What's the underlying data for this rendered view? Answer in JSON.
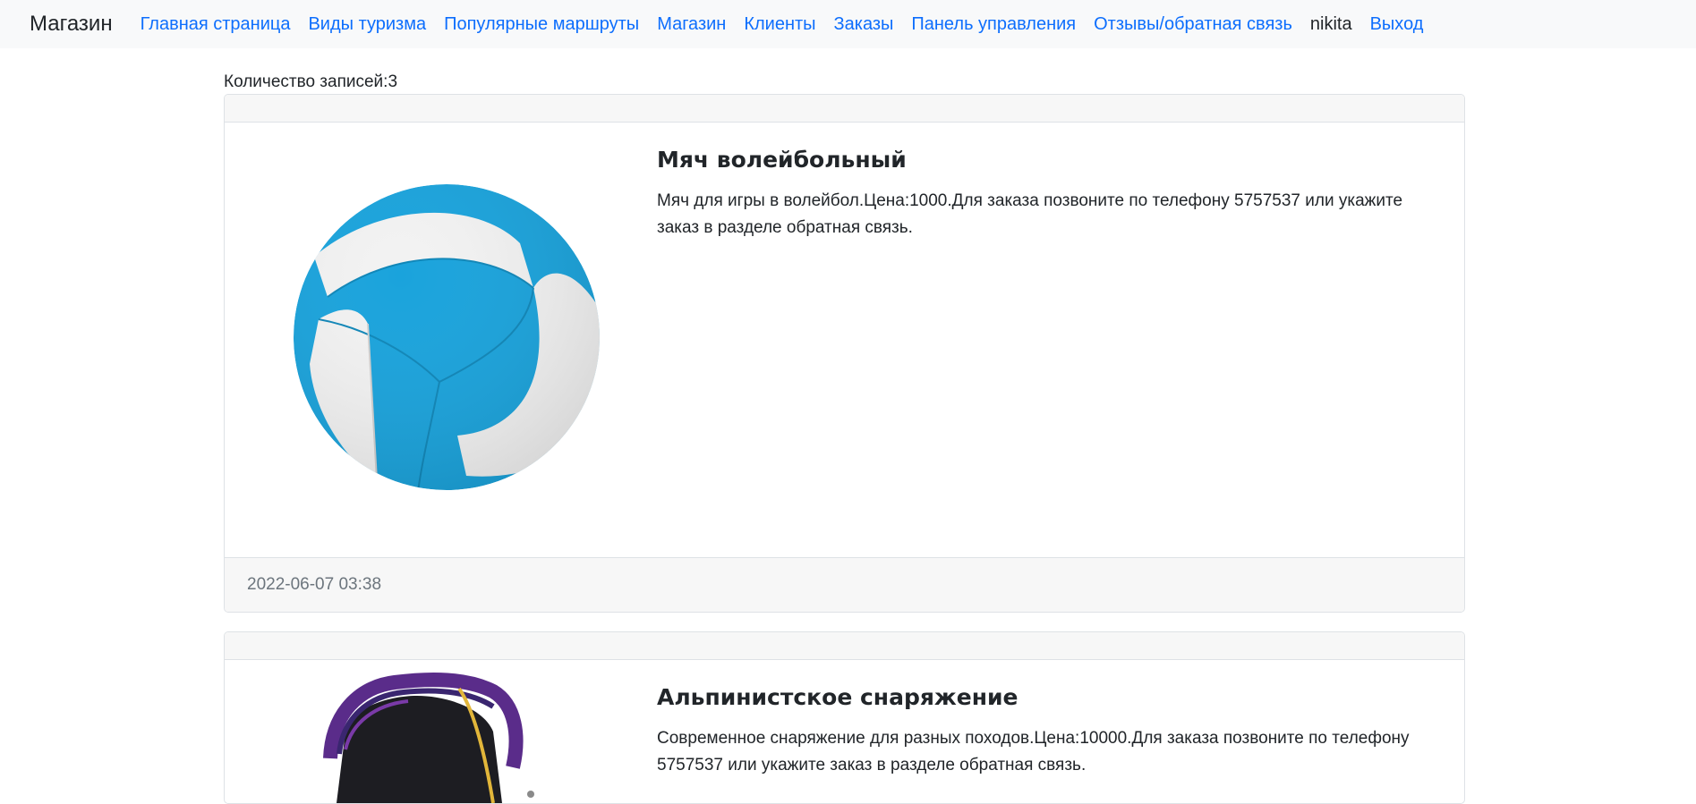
{
  "navbar": {
    "brand": "Магазин",
    "links": [
      "Главная страница",
      "Виды туризма",
      "Популярные маршруты",
      "Магазин",
      "Клиенты",
      "Заказы",
      "Панель управления",
      "Отзывы/обратная связь"
    ],
    "user": "nikita",
    "logout": "Выход"
  },
  "main": {
    "count_label": "Количество записей:3",
    "items": [
      {
        "title": "Мяч волейбольный",
        "description": "Мяч для игры в волейбол.Цена:1000.Для заказа позвоните по телефону 5757537 или укажите заказ в разделе обратная связь.",
        "date": "2022-06-07 03:38",
        "image_icon": "volleyball-image"
      },
      {
        "title": "Альпинистское снаряжение",
        "description": "Современное снаряжение для разных походов.Цена:10000.Для заказа позвоните по телефону 5757537 или укажите заказ в разделе обратная связь.",
        "image_icon": "climbing-gear-image"
      }
    ]
  },
  "colors": {
    "link": "#0d6efd",
    "navbar_bg": "#f8f9fa",
    "card_header_bg": "#f7f7f7",
    "ball_blue": "#1aa3dc"
  }
}
